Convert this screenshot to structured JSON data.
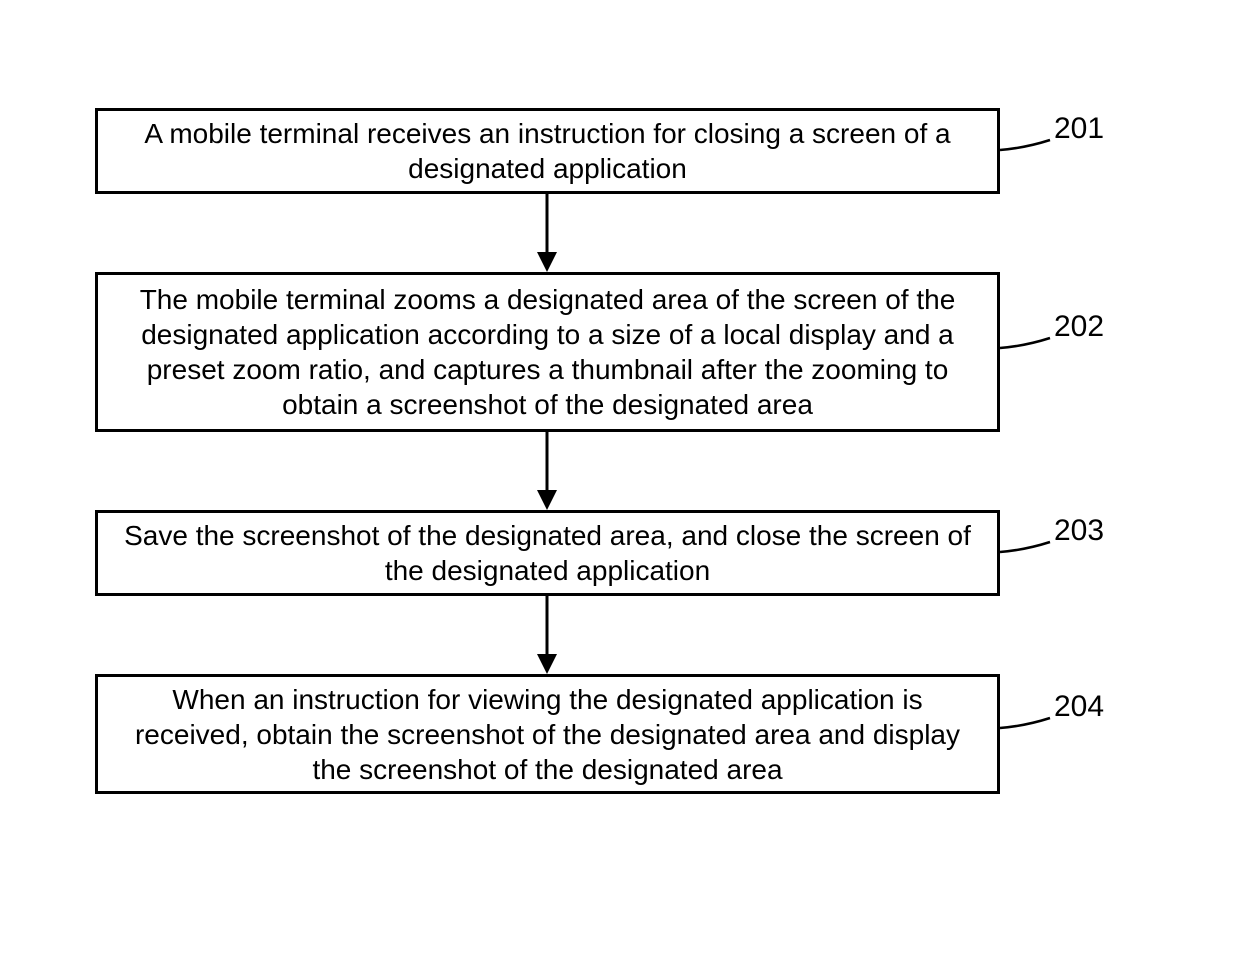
{
  "flow": {
    "steps": [
      {
        "label": "201",
        "text": "A mobile terminal receives an instruction for closing a screen of a designated application"
      },
      {
        "label": "202",
        "text": "The mobile terminal zooms a designated area of the screen of the designated application according to a size of a local display and a preset zoom ratio, and captures a thumbnail after the zooming to obtain a screenshot of the designated area"
      },
      {
        "label": "203",
        "text": "Save the screenshot of the designated area, and close the screen of the designated application"
      },
      {
        "label": "204",
        "text": "When an instruction for viewing the designated application is received, obtain the screenshot of the designated area and display the screenshot of the designated area"
      }
    ]
  }
}
